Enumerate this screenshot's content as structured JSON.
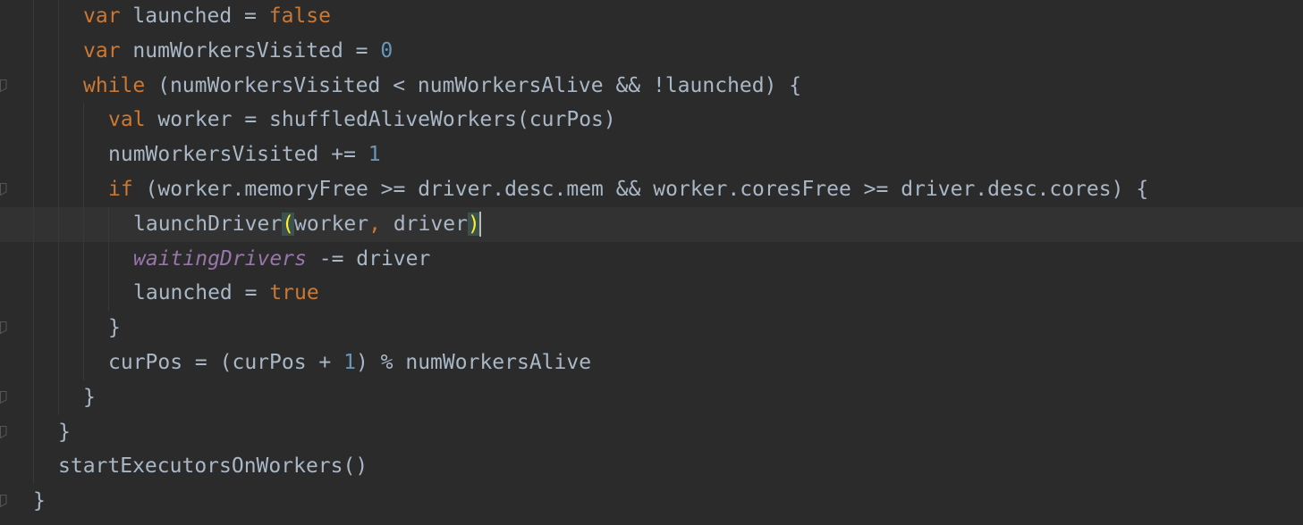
{
  "editor": {
    "lines": [
      {
        "tokens": [
          {
            "t": "var",
            "c": "kw"
          },
          {
            "t": " launched = ",
            "c": "plain"
          },
          {
            "t": "false",
            "c": "kw"
          }
        ]
      },
      {
        "tokens": [
          {
            "t": "var",
            "c": "kw"
          },
          {
            "t": " numWorkersVisited = ",
            "c": "plain"
          },
          {
            "t": "0",
            "c": "num"
          }
        ]
      },
      {
        "tokens": [
          {
            "t": "while",
            "c": "kw"
          },
          {
            "t": " (numWorkersVisited < numWorkersAlive && !launched) {",
            "c": "plain"
          }
        ]
      },
      {
        "tokens": [
          {
            "t": "val",
            "c": "kw"
          },
          {
            "t": " worker = shuffledAliveWorkers(curPos)",
            "c": "plain"
          }
        ]
      },
      {
        "tokens": [
          {
            "t": "numWorkersVisited += ",
            "c": "plain"
          },
          {
            "t": "1",
            "c": "num"
          }
        ]
      },
      {
        "tokens": [
          {
            "t": "if",
            "c": "kw"
          },
          {
            "t": " (worker.memoryFree >= driver.desc.mem && worker.coresFree >= driver.desc.cores) {",
            "c": "plain"
          }
        ]
      },
      {
        "tokens": [
          {
            "t": "launchDriver",
            "c": "plain"
          },
          {
            "t": "(",
            "c": "brace-match"
          },
          {
            "t": "worker",
            "c": "plain"
          },
          {
            "t": ",",
            "c": "kw"
          },
          {
            "t": " driver",
            "c": "plain"
          },
          {
            "t": ")",
            "c": "brace-match"
          }
        ]
      },
      {
        "tokens": [
          {
            "t": "waitingDrivers",
            "c": "field"
          },
          {
            "t": " -= driver",
            "c": "plain"
          }
        ]
      },
      {
        "tokens": [
          {
            "t": "launched = ",
            "c": "plain"
          },
          {
            "t": "true",
            "c": "kw"
          }
        ]
      },
      {
        "tokens": [
          {
            "t": "}",
            "c": "plain"
          }
        ]
      },
      {
        "tokens": [
          {
            "t": "curPos = (curPos + ",
            "c": "plain"
          },
          {
            "t": "1",
            "c": "num"
          },
          {
            "t": ") % numWorkersAlive",
            "c": "plain"
          }
        ]
      },
      {
        "tokens": [
          {
            "t": "}",
            "c": "plain"
          }
        ]
      },
      {
        "tokens": [
          {
            "t": "}",
            "c": "plain"
          }
        ]
      },
      {
        "tokens": [
          {
            "t": "startExecutorsOnWorkers()",
            "c": "plain"
          }
        ]
      },
      {
        "tokens": [
          {
            "t": "}",
            "c": "plain"
          }
        ]
      }
    ]
  },
  "colors": {
    "background": "#2b2b2b",
    "current_line": "#323232",
    "keyword": "#cc7832",
    "number": "#6897bb",
    "field": "#9876aa",
    "text": "#a9b7c6",
    "brace_match_bg": "#3b514d",
    "brace_match_fg": "#ffef28"
  }
}
